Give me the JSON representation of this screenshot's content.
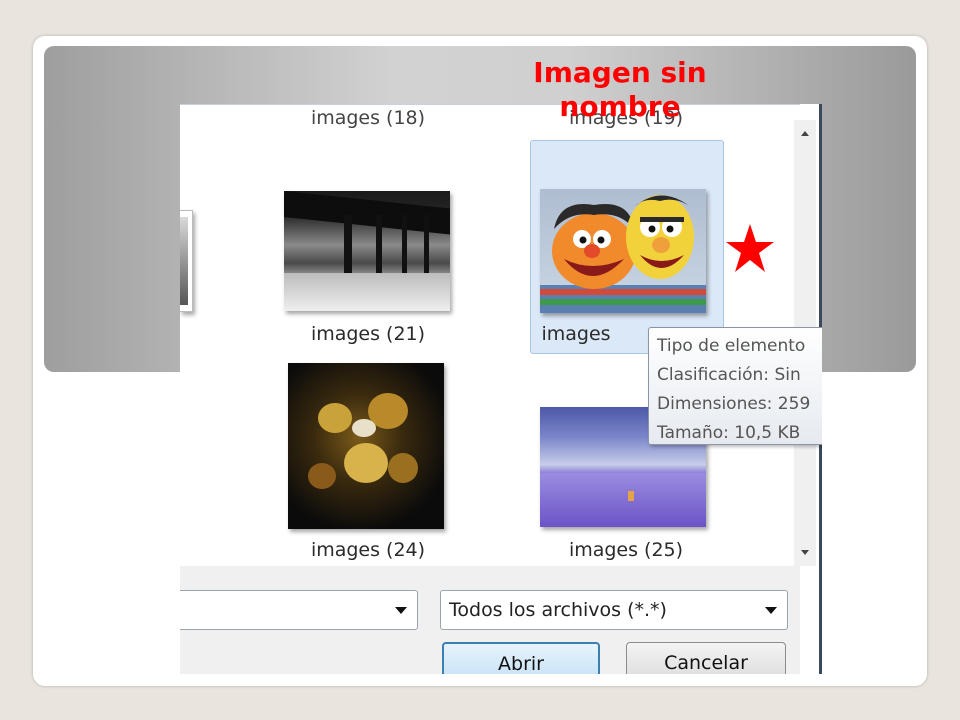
{
  "slide": {
    "title": "Imagen sin nombre",
    "title_color": "#ff0000",
    "marker_icon": "star-icon",
    "marker_color": "#ff0000"
  },
  "dialog": {
    "partial_labels": [
      "images (18)",
      "images (19)"
    ],
    "files": [
      {
        "label": "images (21)",
        "thumbnail": "black-and-white-arcade-photo"
      },
      {
        "label": "images",
        "thumbnail": "sesame-street-puppets-photo",
        "selected": true
      },
      {
        "label": "images (24)",
        "thumbnail": "overhead-drum-kit-photo"
      },
      {
        "label": "images (25)",
        "thumbnail": "purple-sea-sunset-photo"
      }
    ],
    "tooltip": {
      "lines": [
        "Tipo de elemento",
        "Clasificación: Sin",
        "Dimensiones: 259",
        "Tamaño: 10,5 KB"
      ]
    },
    "filename_value": "",
    "filetype_selected": "Todos los archivos (*.*)",
    "open_button": "Abrir",
    "cancel_button": "Cancelar",
    "selection_color": "#dbe8f7",
    "open_button_border": "#3c7fb1"
  }
}
